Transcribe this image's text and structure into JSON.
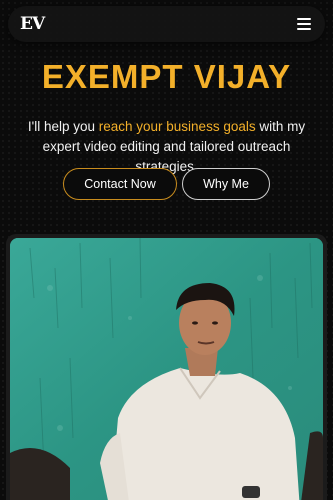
{
  "header": {
    "logo_text": "EV",
    "menu_icon": "hamburger-menu-icon"
  },
  "hero": {
    "title": "EXEMPT VIJAY",
    "text_part1": "I'll help you ",
    "text_highlight": "reach your business goals",
    "text_part2": " with my expert video editing and tailored outreach strategies."
  },
  "buttons": {
    "contact_label": "Contact Now",
    "why_label": "Why Me"
  },
  "colors": {
    "accent": "#f3b02a",
    "background": "#0b0b0b",
    "photo_wall": "#2f9b8a"
  }
}
